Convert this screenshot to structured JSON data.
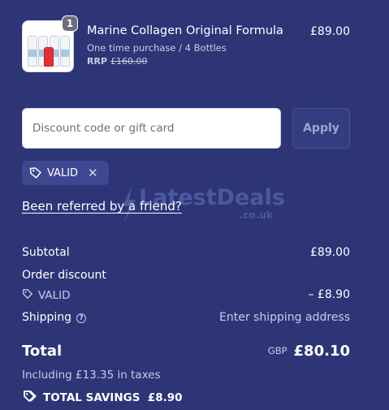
{
  "cart": {
    "item": {
      "title": "Marine Collagen Original Formula",
      "subtitle": "One time purchase / 4 Bottles",
      "rrp_label": "RRP",
      "rrp_price": "£160.00",
      "price": "£89.00",
      "quantity": "1"
    }
  },
  "discount": {
    "placeholder": "Discount code or gift card",
    "apply_label": "Apply",
    "applied_code": "VALID"
  },
  "referral": {
    "link_text": "Been referred by a friend?"
  },
  "watermark": {
    "text": "LatestDeals",
    "sub": ".co.uk"
  },
  "summary": {
    "subtotal_label": "Subtotal",
    "subtotal_value": "£89.00",
    "order_discount_label": "Order discount",
    "discount_code": "VALID",
    "discount_value": "– £8.90",
    "shipping_label": "Shipping",
    "shipping_value": "Enter shipping address",
    "total_label": "Total",
    "currency": "GBP",
    "total_value": "£80.10",
    "taxes_text": "Including £13.35 in taxes",
    "savings_text": "TOTAL SAVINGS  £8.90"
  },
  "colors": {
    "background": "#2d3577",
    "chip": "#3e4890",
    "muted_text": "#c7cbe6"
  },
  "icons": [
    "tag-icon",
    "close-icon",
    "help-icon",
    "savings-tag-icon"
  ]
}
